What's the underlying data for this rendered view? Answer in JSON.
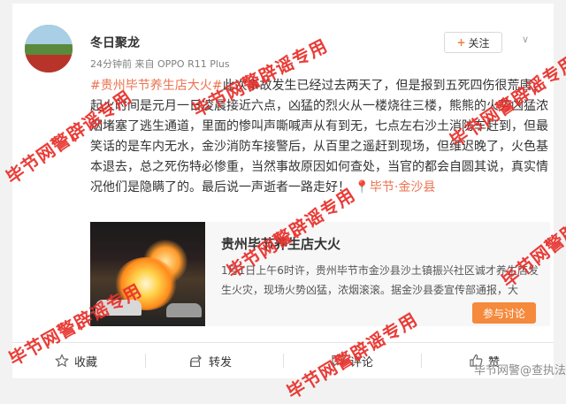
{
  "post": {
    "username": "冬日聚龙",
    "meta": "24分钟前 来自 OPPO R11 Plus",
    "follow_label": "关注",
    "chevron": "∨",
    "hashtag": "#贵州毕节养生店大火#",
    "body": "此次事故发生已经过去两天了，但是报到五死四伤很荒唐，起火时间是元月一日凌晨接近六点，凶猛的烈火从一楼烧往三楼，熊熊的火势凶猛浓烟堵塞了逃生通道，里面的惨叫声嘶喊声从有到无，七点左右沙土消防车赶到，但最笑话的是车内无水，金沙消防车接警后，从百里之遥赶到现场，但维迟晚了，火色基本退去，总之死伤特必惨重，当然事故原因如何查处，当官的都会自圆其说，真实情况他们是隐瞒了的。最后说一声逝者一路走好！",
    "location": "📍毕节·金沙县"
  },
  "repost": {
    "title": "贵州毕节养生店大火",
    "desc": "1月1日上午6时许，贵州毕节市金沙县沙土镇振兴社区诚才养生店发生火灾，现场火势凶猛，浓烟滚滚。据金沙县委宣传部通报，大",
    "discuss_label": "参与讨论"
  },
  "actions": {
    "favorite": "收藏",
    "forward": "转发",
    "comment": "评论",
    "like": "赞"
  },
  "watermark": {
    "text": "毕节网警辟谣专用",
    "source": "毕节网警@查执法"
  },
  "colors": {
    "accent": "#eb7350",
    "watermark": "#e8332e",
    "discuss_button": "#f5893c"
  }
}
